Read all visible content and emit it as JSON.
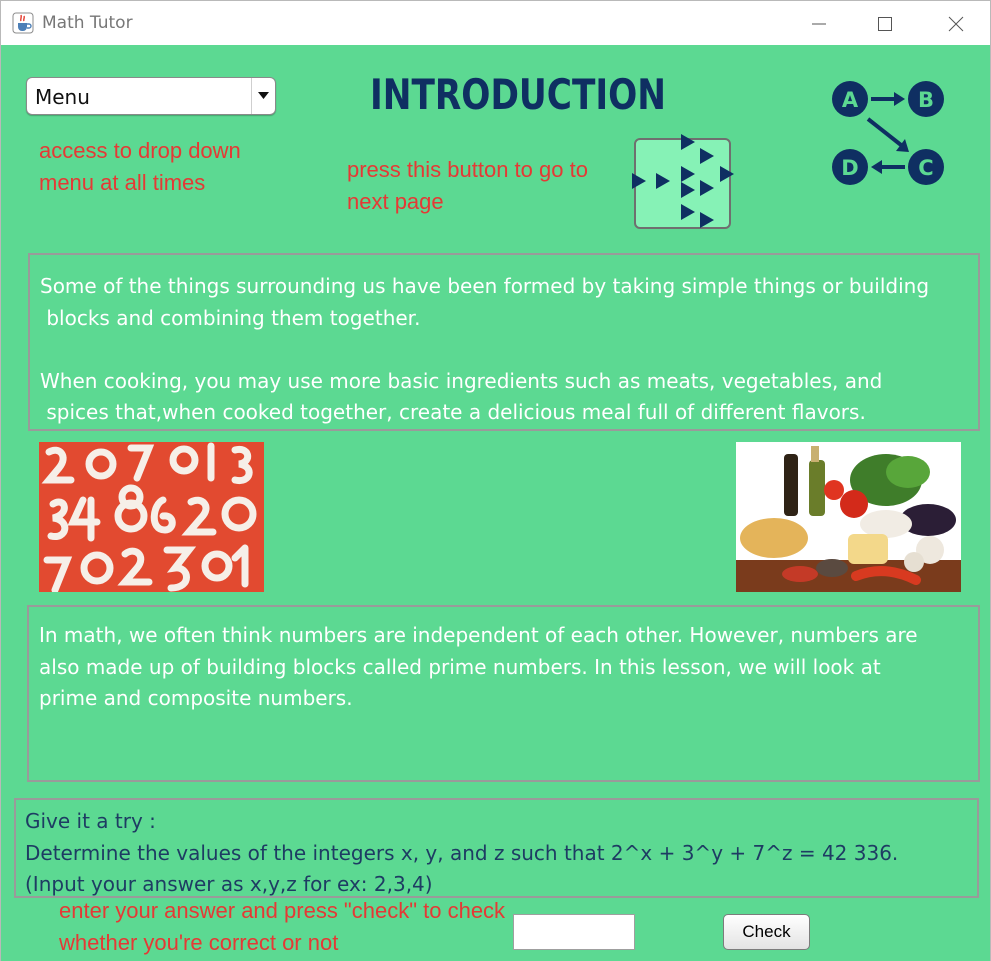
{
  "window": {
    "title": "Math Tutor",
    "icons": {
      "app": "java-cup-icon",
      "minimize": "minimize-icon",
      "maximize": "maximize-icon",
      "close": "close-icon"
    }
  },
  "colors": {
    "background": "#5cd992",
    "hint_text": "#e53935",
    "title_text": "#0f2f62",
    "body_text": "#ffffff",
    "prompt_text": "#1e3c63",
    "next_button_fill": "#86f2b6"
  },
  "menu": {
    "selected": "Menu",
    "icon": "dropdown-arrow-icon"
  },
  "hints": {
    "menu": "access to drop down menu at all times",
    "next": "press this button to go to next page",
    "answer": "enter your answer and press \"check\" to check whether you're correct or not"
  },
  "header": {
    "title": "INTRODUCTION"
  },
  "next_button": {
    "icon": "next-arrows-icon"
  },
  "flow_icon": {
    "nodes": [
      "A",
      "B",
      "C",
      "D"
    ]
  },
  "intro_text": "Some of the things surrounding us have been formed by taking simple things or building\n blocks and combining them together.\n\nWhen cooking, you may use more basic ingredients such as meats, vegetables, and\n spices that,when cooked together, create a delicious meal full of different flavors.",
  "images": {
    "numbers": "numbers-photo",
    "food": "ingredients-photo"
  },
  "math_text": "In math, we often think numbers are independent of each other. However, numbers are\nalso made up of building blocks called prime numbers. In this lesson, we will look at\nprime and composite numbers.",
  "try": {
    "text": "Give it a try :\nDetermine the values of the integers x, y, and z such that 2^x + 3^y + 7^z = 42 336.\n(Input your answer as x,y,z for ex: 2,3,4)"
  },
  "answer": {
    "value": "",
    "check_label": "Check"
  }
}
